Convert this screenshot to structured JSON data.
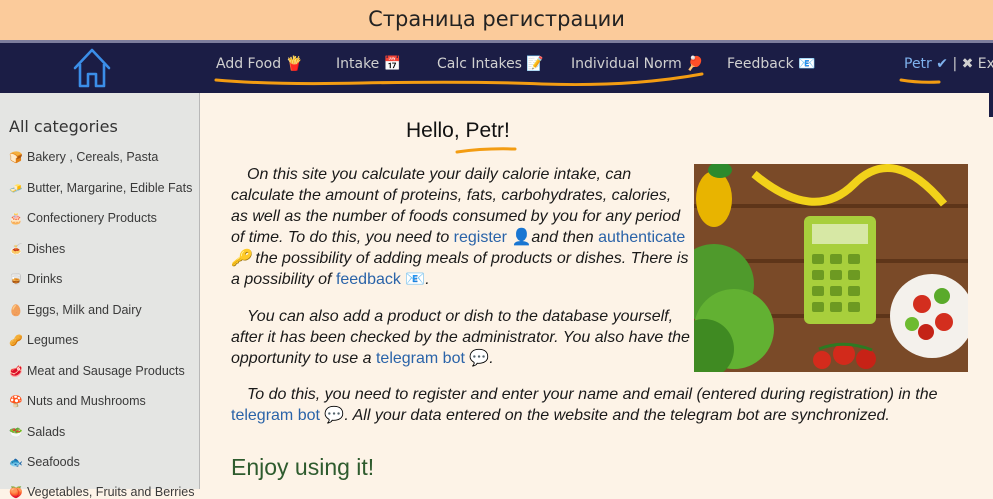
{
  "page_title": "Страница регистрации",
  "nav": {
    "items": [
      {
        "label": "Add Food 🍟"
      },
      {
        "label": "Intake 📅"
      },
      {
        "label": "Calc Intakes 📝"
      },
      {
        "label": "Individual Norm 🏓"
      },
      {
        "label": "Feedback 📧"
      }
    ],
    "user": "Petr ✔",
    "separator": "|",
    "exit": "✖ Exit"
  },
  "sidebar": {
    "title": "All categories",
    "items": [
      {
        "icon": "🍞",
        "label": "Bakery , Cereals, Pasta"
      },
      {
        "icon": "🧈",
        "label": "Butter, Margarine, Edible Fats"
      },
      {
        "icon": "🎂",
        "label": "Confectionery Products"
      },
      {
        "icon": "🍝",
        "label": "Dishes"
      },
      {
        "icon": "🥃",
        "label": "Drinks"
      },
      {
        "icon": "🥚",
        "label": "Eggs, Milk and Dairy"
      },
      {
        "icon": "🥜",
        "label": "Legumes"
      },
      {
        "icon": "🥩",
        "label": "Meat and Sausage Products"
      },
      {
        "icon": "🍄",
        "label": "Nuts and Mushrooms"
      },
      {
        "icon": "🥗",
        "label": "Salads"
      },
      {
        "icon": "🐟",
        "label": "Seafoods"
      },
      {
        "icon": "🍑",
        "label": "Vegetables, Fruits and Berries"
      }
    ]
  },
  "main": {
    "greeting": "Hello, Petr!",
    "p1": {
      "t1": "On this site you calculate your daily calorie intake, can calculate the amount of proteins, fats, carbohydrates, calories, as well as the number of foods consumed by you for any period of time. To do this, you need to ",
      "link_register": "register 👤",
      "t2": "and then ",
      "link_authenticate": "authenticate",
      "t3": " 🔑 the possibility of adding meals of products or dishes. There is a possibility of ",
      "link_feedback": "feedback 📧",
      "t4": "."
    },
    "p2": {
      "t1": "You can also add a product or dish to the database yourself, after it has been checked by the administrator. You also have the opportunity to use a ",
      "link_bot": "telegram bot 💬",
      "t2": "."
    },
    "p3": {
      "t1": "To do this, you need to register and enter your name and email (entered during registration) in the ",
      "link_bot": "telegram bot 💬",
      "t2": ". All your data entered on the website and the telegram bot are synchronized."
    },
    "enjoy": "Enjoy using it!"
  },
  "colors": {
    "header_bg": "#fbcb9b",
    "navbar_bg": "#1b1d45",
    "accent_underline": "#f39c12",
    "link": "#2a63a8",
    "user_link": "#7fb2ee",
    "sidebar_bg": "#e4e5e3",
    "content_bg": "#fdf3e7"
  }
}
